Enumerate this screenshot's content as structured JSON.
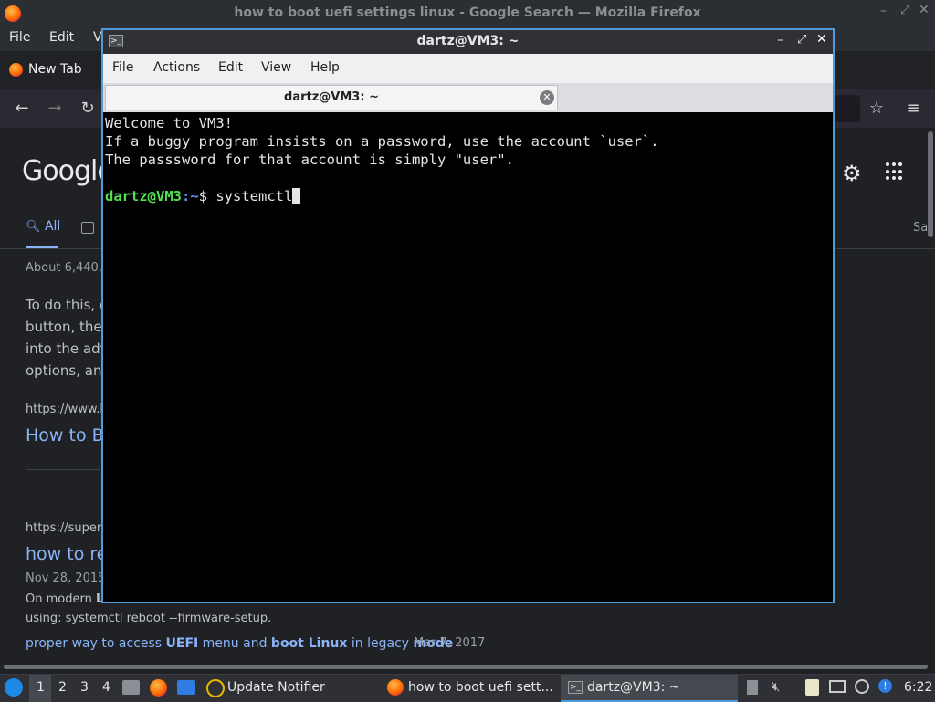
{
  "firefox": {
    "window_title": "how to boot uefi settings linux - Google Search — Mozilla Firefox",
    "menu": [
      "File",
      "Edit",
      "V"
    ],
    "tab_label": "New Tab",
    "google": {
      "logo": "Google",
      "tab_all": "All",
      "tab_right": "Sa",
      "result_count": "About 6,440,",
      "snippet_lines": [
        "To do this, c",
        "button, then",
        "into the adv",
        "options, and"
      ],
      "result1": {
        "url": "https://www.h",
        "title": "How to Bo"
      },
      "result2": {
        "url": "https://superu",
        "title": "how to re",
        "date": "Nov 28, 2015",
        "line1_prefix": "On modern ",
        "line1_bold": "L",
        "line2": "using: systemctl reboot --firmware-setup.",
        "related": {
          "pre": "proper way to access ",
          "b1": "UEFI",
          "mid1": " menu and ",
          "b2": "boot Linux",
          "mid2": " in legacy ",
          "b3": "mode",
          "date": "Mar 7, 2017"
        }
      }
    }
  },
  "terminal": {
    "window_title": "dartz@VM3: ~",
    "menu": [
      "File",
      "Actions",
      "Edit",
      "View",
      "Help"
    ],
    "tab_label": "dartz@VM3: ~",
    "lines": [
      "Welcome to VM3!",
      "If a buggy program insists on a password, use the account `user`.",
      "The passsword for that account is simply \"user\"."
    ],
    "prompt_user": "dartz@VM3",
    "prompt_path": ":~",
    "prompt_symbol": "$ ",
    "command": "systemctl"
  },
  "taskbar": {
    "workspaces": [
      "1",
      "2",
      "3",
      "4"
    ],
    "tasks": [
      "Update Notifier",
      "how to boot uefi sett...",
      "dartz@VM3: ~"
    ],
    "clock": "6:22"
  },
  "colors": {
    "prompt_green": "#54e054",
    "prompt_blue": "#6e8ff5",
    "terminal_border": "#4f9ad8"
  }
}
